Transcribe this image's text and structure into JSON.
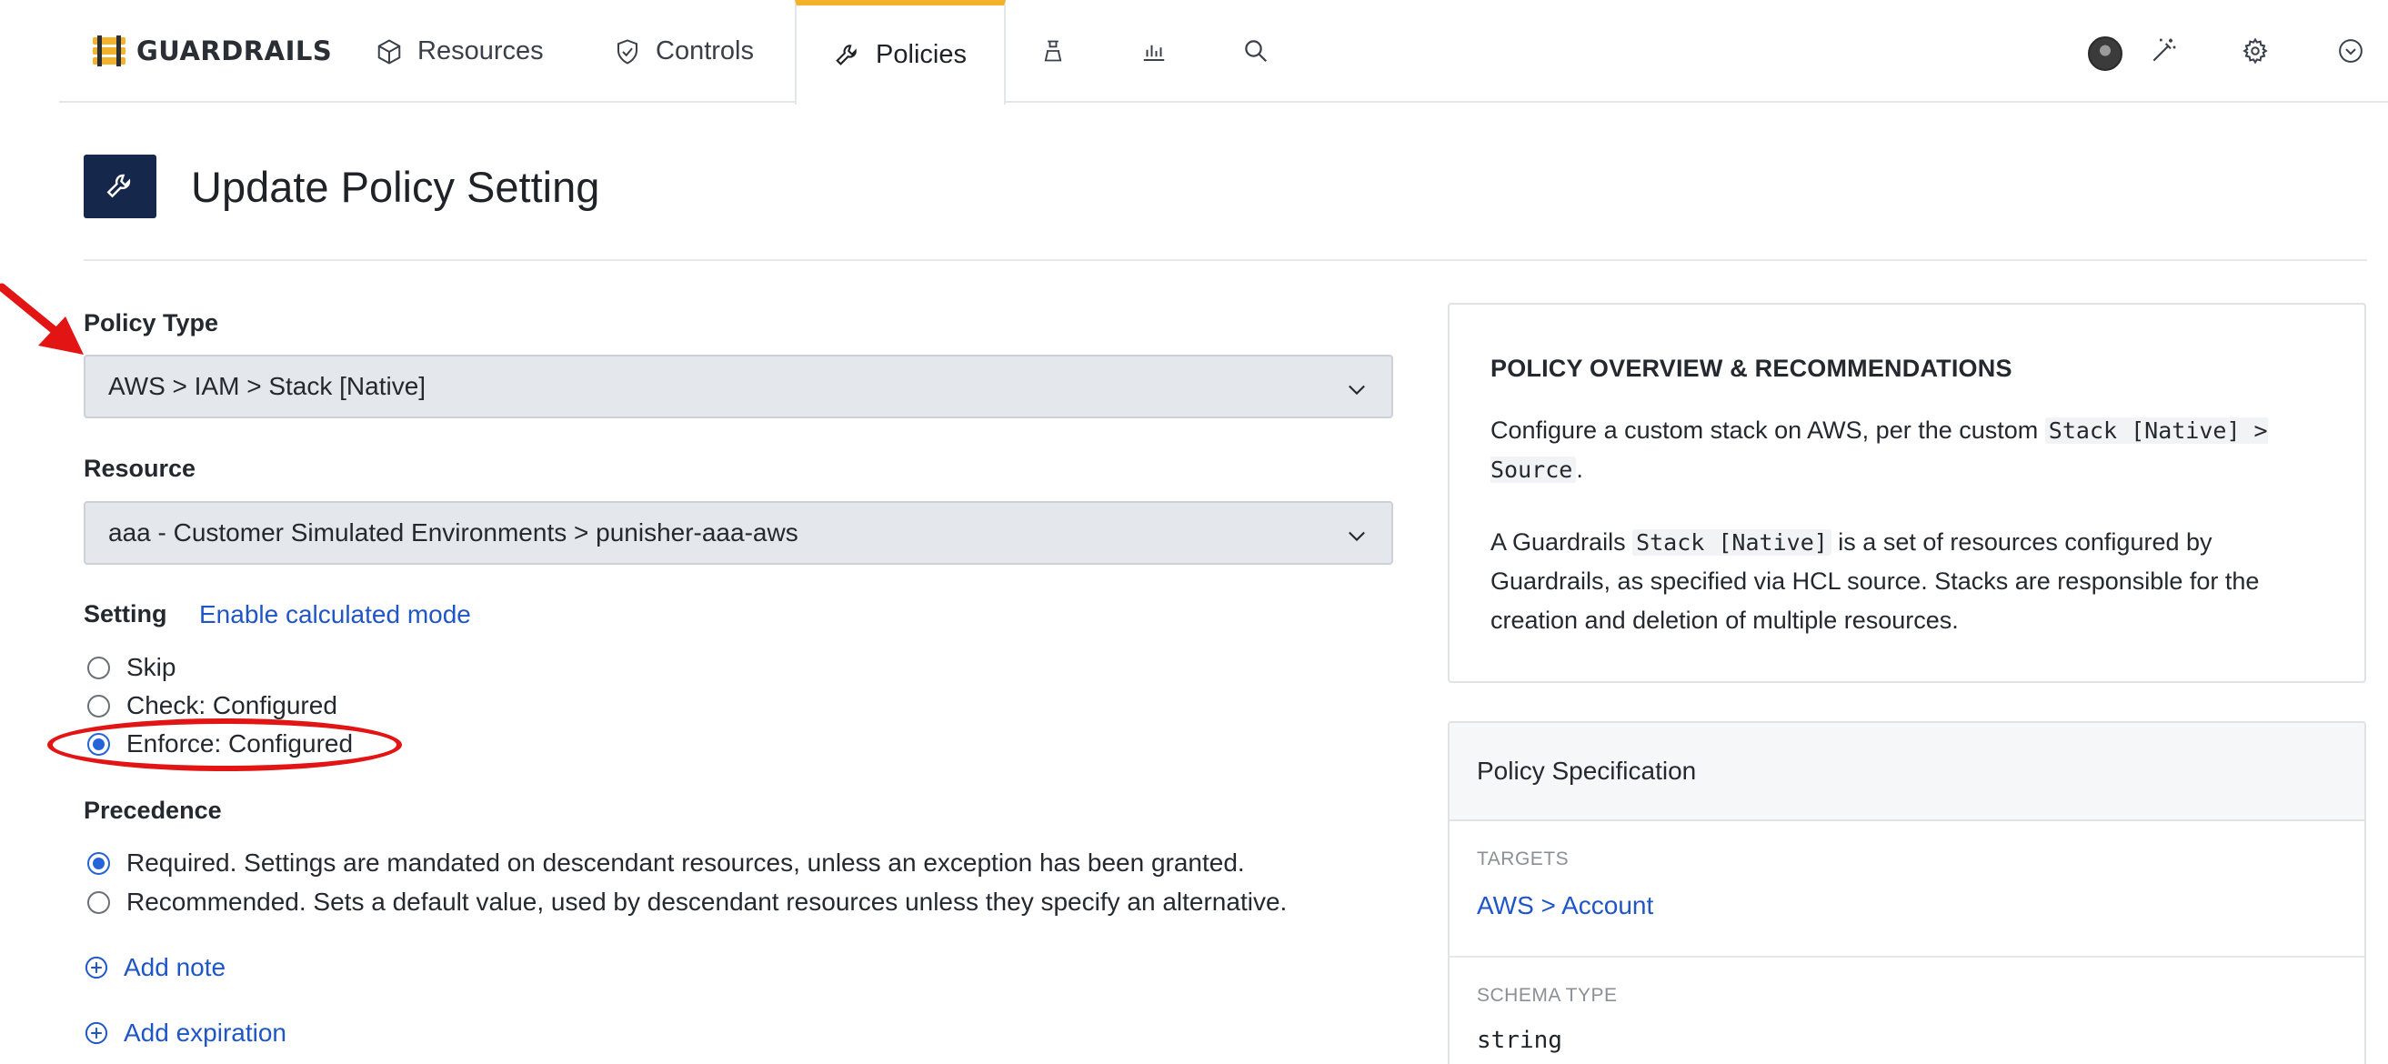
{
  "nav": {
    "logo_text": "GUARDRAILS",
    "tabs": [
      {
        "label": "Resources",
        "icon": "cube-icon"
      },
      {
        "label": "Controls",
        "icon": "shield-check-icon"
      },
      {
        "label": "Policies",
        "icon": "wrench-icon",
        "active": true
      }
    ],
    "icon_buttons": [
      "beaker-icon",
      "bar-chart-icon",
      "search-icon"
    ],
    "right_icons": [
      "avatar",
      "magic-wand-icon",
      "gear-icon",
      "chevron-circle-icon"
    ],
    "accent_color": "#f2b32b"
  },
  "page": {
    "title": "Update Policy Setting",
    "header_icon": "wrench-icon",
    "header_color": "#15284b"
  },
  "form": {
    "policy_type": {
      "label": "Policy Type",
      "value": "AWS > IAM > Stack [Native]"
    },
    "resource": {
      "label": "Resource",
      "value": "aaa - Customer Simulated Environments > punisher-aaa-aws"
    },
    "setting": {
      "label": "Setting",
      "calc_link": "Enable calculated mode",
      "options": [
        {
          "label": "Skip",
          "checked": false
        },
        {
          "label": "Check: Configured",
          "checked": false
        },
        {
          "label": "Enforce: Configured",
          "checked": true
        }
      ]
    },
    "precedence": {
      "label": "Precedence",
      "options": [
        {
          "label": "Required. Settings are mandated on descendant resources, unless an exception has been granted.",
          "checked": true
        },
        {
          "label": "Recommended. Sets a default value, used by descendant resources unless they specify an alternative.",
          "checked": false
        }
      ]
    },
    "add_note": "Add note",
    "add_expiration": "Add expiration"
  },
  "overview": {
    "title": "POLICY OVERVIEW & RECOMMENDATIONS",
    "p1_a": "Configure a custom stack on AWS, per the custom ",
    "p1_code": "Stack [Native] > Source",
    "p1_b": ".",
    "p2_a": "A Guardrails ",
    "p2_code": "Stack [Native]",
    "p2_b": " is a set of resources configured by Guardrails, as specified via HCL source. Stacks are responsible for the creation and deletion of multiple resources."
  },
  "spec": {
    "title": "Policy Specification",
    "targets_caption": "TARGETS",
    "targets_value": "AWS > Account",
    "schema_caption": "SCHEMA TYPE",
    "schema_value": "string"
  },
  "annotation_color": "#e31414"
}
